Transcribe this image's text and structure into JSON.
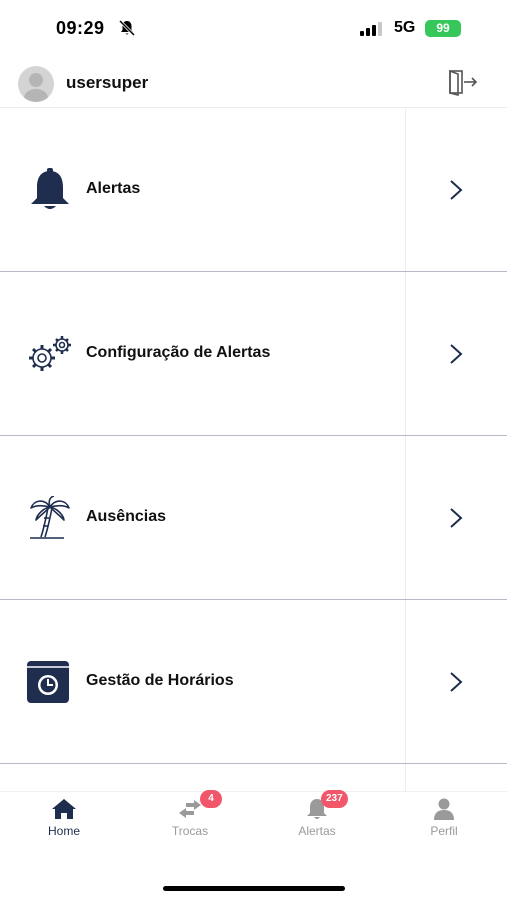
{
  "status_bar": {
    "time": "09:29",
    "network": "5G",
    "battery": "99"
  },
  "header": {
    "username": "usersuper",
    "icons": {
      "avatar": "user-avatar",
      "logout": "logout-door-icon"
    }
  },
  "menu": {
    "items": [
      {
        "label": "Alertas",
        "icon": "bell-icon"
      },
      {
        "label": "Configuração de Alertas",
        "icon": "gears-icon"
      },
      {
        "label": "Ausências",
        "icon": "palm-tree-icon"
      },
      {
        "label": "Gestão de Horários",
        "icon": "clock-calendar-icon"
      }
    ]
  },
  "tab_bar": {
    "tabs": [
      {
        "label": "Home",
        "icon": "home-icon",
        "active": true
      },
      {
        "label": "Trocas",
        "icon": "swap-icon",
        "badge": "4"
      },
      {
        "label": "Alertas",
        "icon": "bell-icon",
        "badge": "237"
      },
      {
        "label": "Perfil",
        "icon": "person-icon"
      }
    ]
  },
  "colors": {
    "navy": "#1f2d4e",
    "badge": "#f2566a",
    "battery": "#35c759",
    "inactive": "#9a9a9a"
  }
}
